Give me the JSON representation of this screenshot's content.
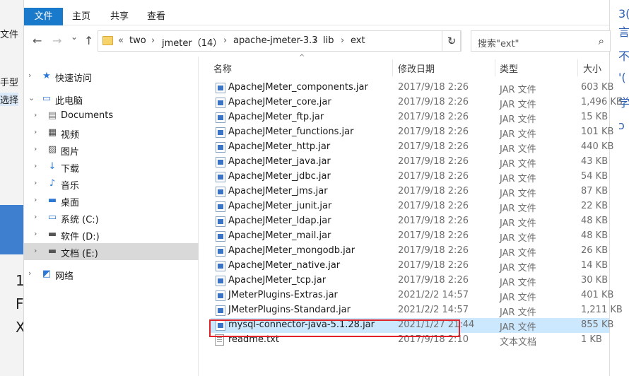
{
  "background": {
    "left_fragments": [
      "文件",
      "手型",
      "选择",
      "1",
      "F",
      "X"
    ],
    "right_fragments": [
      "3(",
      "言",
      "不",
      "'(",
      "学",
      "ɔ"
    ]
  },
  "ribbon": {
    "tabs": [
      {
        "label": "文件",
        "active": true
      },
      {
        "label": "主页",
        "active": false
      },
      {
        "label": "共享",
        "active": false
      },
      {
        "label": "查看",
        "active": false
      }
    ]
  },
  "toolbar": {
    "back_icon": "←",
    "forward_icon": "→",
    "recent_icon": "⌄",
    "up_icon": "↑",
    "refresh_icon": "↻"
  },
  "address": {
    "prefix": "«",
    "segments": [
      "two",
      "jmeter（14）",
      "apache-jmeter-3.3",
      "lib",
      "ext"
    ],
    "separator": "›"
  },
  "search": {
    "placeholder": "搜索\"ext\"",
    "icon": "⌕"
  },
  "nav": {
    "items": [
      {
        "label": "快速访问",
        "icon": "★",
        "color": "#2b78d6",
        "indent": 0,
        "expander": "›",
        "selected": false
      },
      {
        "label": "此电脑",
        "icon": "▭",
        "color": "#2b78d6",
        "indent": 0,
        "expander": "⌄",
        "selected": false
      },
      {
        "label": "Documents",
        "icon": "▤",
        "color": "#777",
        "indent": 1,
        "expander": "›",
        "selected": false
      },
      {
        "label": "视频",
        "icon": "▦",
        "color": "#444",
        "indent": 1,
        "expander": "›",
        "selected": false
      },
      {
        "label": "图片",
        "icon": "▨",
        "color": "#555",
        "indent": 1,
        "expander": "›",
        "selected": false
      },
      {
        "label": "下载",
        "icon": "↓",
        "color": "#2b78d6",
        "indent": 1,
        "expander": "›",
        "selected": false
      },
      {
        "label": "音乐",
        "icon": "♪",
        "color": "#2b78d6",
        "indent": 1,
        "expander": "›",
        "selected": false
      },
      {
        "label": "桌面",
        "icon": "▬",
        "color": "#2b78d6",
        "indent": 1,
        "expander": "›",
        "selected": false
      },
      {
        "label": "系统 (C:)",
        "icon": "▭",
        "color": "#2b78d6",
        "indent": 1,
        "expander": "›",
        "selected": false
      },
      {
        "label": "软件 (D:)",
        "icon": "▬",
        "color": "#555",
        "indent": 1,
        "expander": "›",
        "selected": false
      },
      {
        "label": "文档 (E:)",
        "icon": "▬",
        "color": "#555",
        "indent": 1,
        "expander": "›",
        "selected": true
      },
      {
        "label": "网络",
        "icon": "◩",
        "color": "#2b78d6",
        "indent": 0,
        "expander": "›",
        "selected": false
      }
    ]
  },
  "columns": {
    "name": "名称",
    "modified": "修改日期",
    "type": "类型",
    "size": "大小",
    "sort_icon": "^"
  },
  "files": [
    {
      "name": "ApacheJMeter_components.jar",
      "modified": "2017/9/18 2:26",
      "type": "JAR 文件",
      "size": "603 KB",
      "kind": "jar",
      "selected": false
    },
    {
      "name": "ApacheJMeter_core.jar",
      "modified": "2017/9/18 2:26",
      "type": "JAR 文件",
      "size": "1,496 KB",
      "kind": "jar",
      "selected": false
    },
    {
      "name": "ApacheJMeter_ftp.jar",
      "modified": "2017/9/18 2:26",
      "type": "JAR 文件",
      "size": "15 KB",
      "kind": "jar",
      "selected": false
    },
    {
      "name": "ApacheJMeter_functions.jar",
      "modified": "2017/9/18 2:26",
      "type": "JAR 文件",
      "size": "101 KB",
      "kind": "jar",
      "selected": false
    },
    {
      "name": "ApacheJMeter_http.jar",
      "modified": "2017/9/18 2:26",
      "type": "JAR 文件",
      "size": "440 KB",
      "kind": "jar",
      "selected": false
    },
    {
      "name": "ApacheJMeter_java.jar",
      "modified": "2017/9/18 2:26",
      "type": "JAR 文件",
      "size": "43 KB",
      "kind": "jar",
      "selected": false
    },
    {
      "name": "ApacheJMeter_jdbc.jar",
      "modified": "2017/9/18 2:26",
      "type": "JAR 文件",
      "size": "54 KB",
      "kind": "jar",
      "selected": false
    },
    {
      "name": "ApacheJMeter_jms.jar",
      "modified": "2017/9/18 2:26",
      "type": "JAR 文件",
      "size": "87 KB",
      "kind": "jar",
      "selected": false
    },
    {
      "name": "ApacheJMeter_junit.jar",
      "modified": "2017/9/18 2:26",
      "type": "JAR 文件",
      "size": "22 KB",
      "kind": "jar",
      "selected": false
    },
    {
      "name": "ApacheJMeter_ldap.jar",
      "modified": "2017/9/18 2:26",
      "type": "JAR 文件",
      "size": "48 KB",
      "kind": "jar",
      "selected": false
    },
    {
      "name": "ApacheJMeter_mail.jar",
      "modified": "2017/9/18 2:26",
      "type": "JAR 文件",
      "size": "48 KB",
      "kind": "jar",
      "selected": false
    },
    {
      "name": "ApacheJMeter_mongodb.jar",
      "modified": "2017/9/18 2:26",
      "type": "JAR 文件",
      "size": "26 KB",
      "kind": "jar",
      "selected": false
    },
    {
      "name": "ApacheJMeter_native.jar",
      "modified": "2017/9/18 2:26",
      "type": "JAR 文件",
      "size": "14 KB",
      "kind": "jar",
      "selected": false
    },
    {
      "name": "ApacheJMeter_tcp.jar",
      "modified": "2017/9/18 2:26",
      "type": "JAR 文件",
      "size": "30 KB",
      "kind": "jar",
      "selected": false
    },
    {
      "name": "JMeterPlugins-Extras.jar",
      "modified": "2021/2/2 14:57",
      "type": "JAR 文件",
      "size": "401 KB",
      "kind": "jar",
      "selected": false
    },
    {
      "name": "JMeterPlugins-Standard.jar",
      "modified": "2021/2/2 14:57",
      "type": "JAR 文件",
      "size": "1,211 KB",
      "kind": "jar",
      "selected": false
    },
    {
      "name": "mysql-connector-java-5.1.28.jar",
      "modified": "2021/1/27 21:44",
      "type": "JAR 文件",
      "size": "855 KB",
      "kind": "jar",
      "selected": true
    },
    {
      "name": "readme.txt",
      "modified": "2017/9/18 2:10",
      "type": "文本文档",
      "size": "1 KB",
      "kind": "txt",
      "selected": false
    }
  ],
  "colors": {
    "accent": "#1979ca",
    "selection": "#cce8ff",
    "highlight_box": "#e0222b"
  }
}
